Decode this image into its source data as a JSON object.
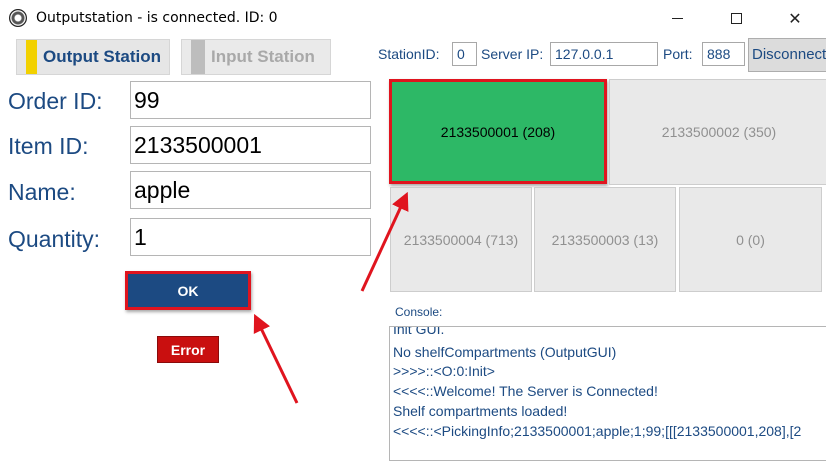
{
  "window": {
    "title": "Outputstation - is connected. ID: 0",
    "controls": {
      "minimize": "minimize",
      "maximize": "maximize",
      "close": "✕"
    }
  },
  "stations": {
    "output_label": "Output Station",
    "input_label": "Input Station",
    "output_accent": "#f2d100"
  },
  "connection": {
    "station_id_label": "StationID:",
    "station_id_value": "0",
    "server_ip_label": "Server IP:",
    "server_ip_value": "127.0.0.1",
    "port_label": "Port:",
    "port_value": "888",
    "disconnect_label": "Disconnect"
  },
  "form": {
    "order_id_label": "Order ID:",
    "order_id_value": "99",
    "item_id_label": "Item ID:",
    "item_id_value": "2133500001",
    "name_label": "Name:",
    "name_value": "apple",
    "quantity_label": "Quantity:",
    "quantity_value": "1",
    "ok_label": "OK",
    "error_label": "Error"
  },
  "compartments": [
    {
      "label": "2133500001 (208)",
      "active": true
    },
    {
      "label": "2133500002 (350)",
      "active": false
    },
    {
      "label": "2133500004 (713)",
      "active": false
    },
    {
      "label": "2133500003 (13)",
      "active": false
    },
    {
      "label": "0 (0)",
      "active": false
    }
  ],
  "console": {
    "label": "Console:",
    "lines": [
      "Init GUI.",
      "No shelfCompartments (OutputGUI)",
      ">>>>::<O:0:Init>",
      "<<<<::Welcome! The Server is Connected!",
      "Shelf compartments loaded!",
      "<<<<::<PickingInfo;2133500001;apple;1;99;[[[2133500001,208],[2"
    ]
  },
  "colors": {
    "accent_blue": "#1c4a82",
    "active_green": "#2db866",
    "highlight_red": "#e0141e",
    "error_red": "#c90f0f"
  }
}
